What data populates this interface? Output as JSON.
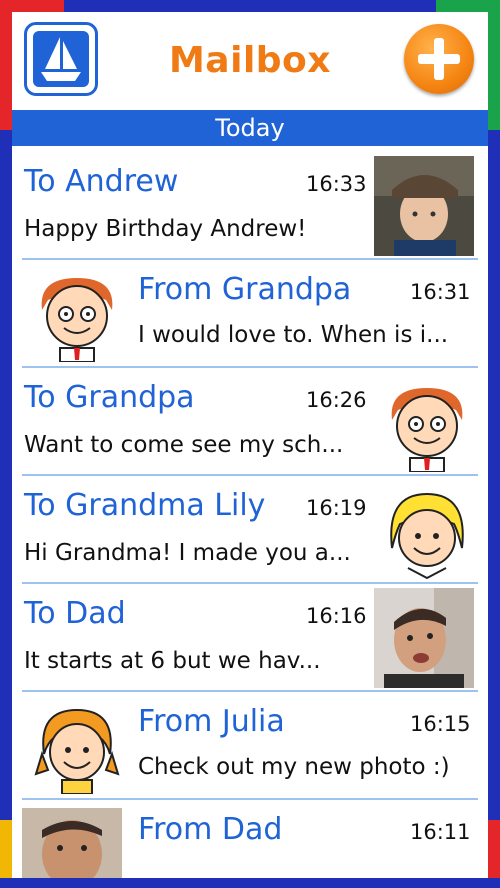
{
  "app": {
    "title": "Mailbox",
    "section_label": "Today"
  },
  "colors": {
    "accent_blue": "#1f63d6",
    "accent_orange": "#f07a14",
    "divider": "#9ec3ee"
  },
  "messages": [
    {
      "name": "To Andrew",
      "time": "16:33",
      "text": "Happy Birthday Andrew!",
      "avatar": "photo-andrew",
      "side": "right"
    },
    {
      "name": "From Grandpa",
      "time": "16:31",
      "text": "I would love to. When is i...",
      "avatar": "grandpa-cartoon",
      "side": "left"
    },
    {
      "name": "To Grandpa",
      "time": "16:26",
      "text": "Want to come see my sch...",
      "avatar": "grandpa-cartoon",
      "side": "right"
    },
    {
      "name": "To Grandma Lily",
      "time": "16:19",
      "text": "Hi Grandma! I made you a...",
      "avatar": "grandma-cartoon",
      "side": "right"
    },
    {
      "name": "To Dad",
      "time": "16:16",
      "text": "It starts at 6 but we hav...",
      "avatar": "photo-dad",
      "side": "right"
    },
    {
      "name": "From Julia",
      "time": "16:15",
      "text": "Check out my new photo :)",
      "avatar": "girl-cartoon",
      "side": "left"
    },
    {
      "name": "From Dad",
      "time": "16:11",
      "text": "",
      "avatar": "photo-dad",
      "side": "left"
    }
  ]
}
